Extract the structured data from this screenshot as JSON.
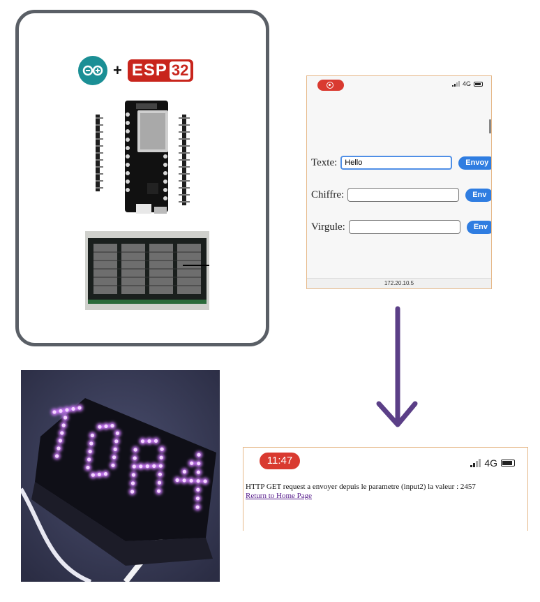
{
  "logos": {
    "plus": "+",
    "esp_text": "ESP",
    "esp_number": "32"
  },
  "phone_form": {
    "status": {
      "network": "4G"
    },
    "fields": [
      {
        "label": "Texte:",
        "value": "Hello",
        "button": "Envoy"
      },
      {
        "label": "Chiffre:",
        "value": "",
        "button": "Env"
      },
      {
        "label": "Virgule:",
        "value": "",
        "button": "Env"
      }
    ],
    "url": "172.20.10.5"
  },
  "phone_response": {
    "time": "11:47",
    "network": "4G",
    "message": "HTTP GET request a envoyer depuis le parametre (input2) la valeur : 2457",
    "link": "Return to Home Page"
  },
  "colors": {
    "arrow": "#5b3f87",
    "led": "#c86bff",
    "button_blue": "#2f7de1",
    "record_red": "#d93a30"
  }
}
